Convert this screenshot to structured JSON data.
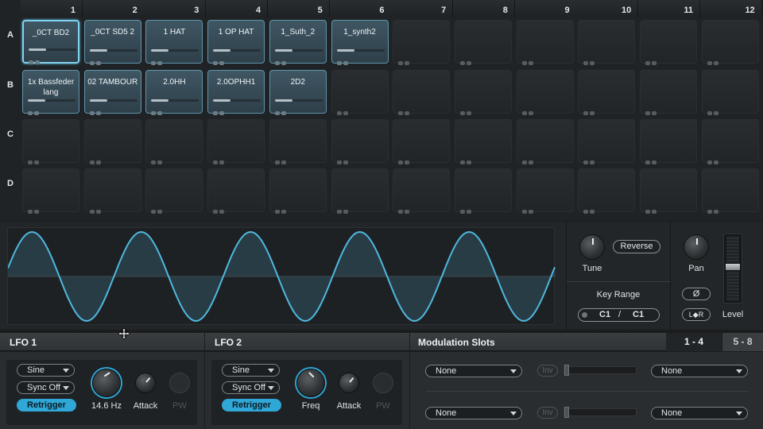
{
  "grid": {
    "columns": [
      "1",
      "2",
      "3",
      "4",
      "5",
      "6",
      "7",
      "8",
      "9",
      "10",
      "11",
      "12"
    ],
    "rows": [
      "A",
      "B",
      "C",
      "D"
    ],
    "pads": {
      "A": [
        "_0CT BD2",
        "_0CT SD5  2",
        "1 HAT",
        "1 OP HAT",
        "1_Suth_2",
        "1_synth2",
        "",
        "",
        "",
        "",
        "",
        ""
      ],
      "B": [
        "1x Bassfeder lang",
        "02 TAMBOUR",
        "2.0HH",
        "2.0OPHH1",
        "2D2",
        "",
        "",
        "",
        "",
        "",
        "",
        ""
      ],
      "C": [
        "",
        "",
        "",
        "",
        "",
        "",
        "",
        "",
        "",
        "",
        "",
        ""
      ],
      "D": [
        "",
        "",
        "",
        "",
        "",
        "",
        "",
        "",
        "",
        "",
        "",
        ""
      ]
    },
    "selected_pad": "A1"
  },
  "tune_panel": {
    "tune_label": "Tune",
    "reverse_label": "Reverse",
    "key_range_label": "Key Range",
    "key_range_low": "C1",
    "key_range_sep": "/",
    "key_range_high": "C1"
  },
  "pan_panel": {
    "pan_label": "Pan",
    "phase_label": "Ø",
    "lr_label": "L◆R",
    "level_label": "Level"
  },
  "lfo1": {
    "title": "LFO 1",
    "waveform": "Sine",
    "sync": "Sync Off",
    "retrigger": "Retrigger",
    "freq_value": "14.6 Hz",
    "attack_label": "Attack",
    "pw_label": "PW"
  },
  "lfo2": {
    "title": "LFO 2",
    "waveform": "Sine",
    "sync": "Sync Off",
    "retrigger": "Retrigger",
    "freq_label": "Freq",
    "attack_label": "Attack",
    "pw_label": "PW"
  },
  "modulation": {
    "title": "Modulation Slots",
    "tab1": "1 - 4",
    "tab2": "5 - 8",
    "slots": [
      {
        "source": "None",
        "inv": "Inv",
        "target": "None"
      },
      {
        "source": "None",
        "inv": "Inv",
        "target": "None"
      }
    ]
  },
  "colors": {
    "accent": "#2fa8d8",
    "pad_filled": "#3f5663",
    "wave": "#4fb8df"
  },
  "icons": {
    "cursor": "move-cursor-icon"
  }
}
